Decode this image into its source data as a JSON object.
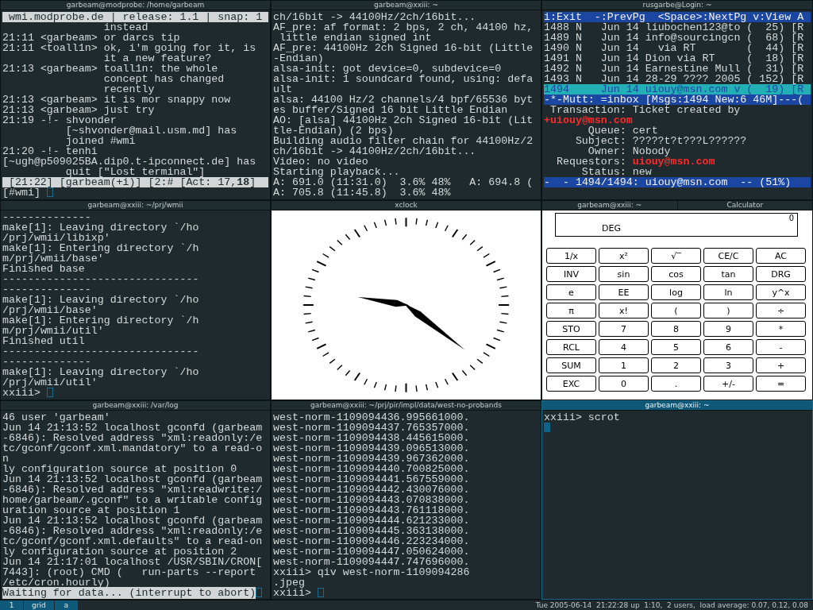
{
  "panes": [
    {
      "kind": "irc",
      "title": "garbeam@modprobe: /home/garbeam",
      "focused": false,
      "topic": " wmi.modprobe.de | release: 1.1 | snap: 1",
      "lines": [
        "                instead",
        "21:11 <garbeam> or darcs tip",
        "21:11 <toall1n> ok, i'm going for it, is",
        "                it a new feature?",
        "21:13 <garbeam> toall1n: the whole",
        "                concept has changed",
        "                recently",
        "21:13 <garbeam> it is mor snappy now",
        "21:13 <garbeam> just try",
        "21:19 -!- shvonder",
        "          [~shvonder@mail.usm.md] has",
        "          joined #wmi",
        "21:20 -!- tenhi",
        "[~ugh@p509025BA.dip0.t-ipconnect.de] has",
        "          quit [\"Lost terminal\"]"
      ],
      "status": " [21:22] [garbeam(+i)] [2:# [Act: 17,**18**]",
      "input": {
        "text": "[#wmi]",
        "highlighted": false
      },
      "cursor": true
    },
    {
      "kind": "terminal",
      "title": "garbeam@xxiii: ~",
      "focused": false,
      "lines": [
        "ch/16bit -> 44100Hz/2ch/16bit...",
        "AF_pre: af format: 2 bps, 2 ch, 44100 hz,",
        " little endian signed int",
        "AF_pre: 44100Hz 2ch Signed 16-bit (Little",
        "-Endian)",
        "alsa-init: got device=0, subdevice=0",
        "alsa-init: 1 soundcard found, using: defa",
        "ult",
        "alsa: 44100 Hz/2 channels/4 bpf/65536 byt",
        "es buffer/Signed 16 bit Little Endian",
        "AO: [alsa] 44100Hz 2ch Signed 16-bit (Lit",
        "tle-Endian) (2 bps)",
        "Building audio filter chain for 44100Hz/2",
        "ch/16bit -> 44100Hz/2ch/16bit...",
        "Video: no video",
        "Starting playback...",
        "A: 691.0 (11:31.0)  3.6% 48%   A: 694.8 (",
        "A: 705.8 (11:45.8)  3.6% 48%"
      ]
    },
    {
      "kind": "mutt",
      "title": "rusgarbe@Login: ~",
      "focused": false,
      "help": "i:Exit  -:PrevPg  <Space>:NextPg v:View A",
      "messages": [
        {
          "text": "1488 N   Jun 14 liubochen123@to (  25) [R",
          "selected": false
        },
        {
          "text": "1489 N   Jun 14 info@sourcingcn (  68) [R",
          "selected": false
        },
        {
          "text": "1490 N   Jun 14   via RT        (  44) [R",
          "selected": false
        },
        {
          "text": "1491 N   Jun 14 Dion via RT     (  18) [R",
          "selected": false
        },
        {
          "text": "1492 N   Jun 14 Earnestine Mull (  31) [R",
          "selected": false
        },
        {
          "text": "1493 N   Jun 14 28-29 ???? 2005 ( 152) [R",
          "selected": false
        },
        {
          "text": "1494     Jun 14 uiouy@msn.com v (  19) [R",
          "selected": true
        }
      ],
      "status": "-*-Mutt: =inbox [Msgs:1494 New:6 46M]---(",
      "body": [
        {
          "text": " Transaction: Ticket created by",
          "highlighted": false
        },
        {
          "text": "+uiouy@msn.com",
          "highlighted": true
        }
      ],
      "headers": [
        {
          "label": "Queue:",
          "value": "cert",
          "highlighted": false
        },
        {
          "label": "Subject:",
          "value": "?????t?t???L??????",
          "highlighted": false
        },
        {
          "label": "Owner:",
          "value": "Nobody",
          "highlighted": false
        },
        {
          "label": "Requestors:",
          "value": "uiouy@msn.com",
          "highlighted": true
        },
        {
          "label": "Status:",
          "value": "new",
          "highlighted": false
        }
      ],
      "pager_status": "-  - 1494/1494: uiouy@msn.com  -- (51%)"
    },
    {
      "kind": "terminal",
      "title": "garbeam@xxiii: ~/prj/wmii",
      "focused": false,
      "lines": [
        "--------------",
        "make[1]: Leaving directory `/ho",
        "/prj/wmii/libixp'",
        "make[1]: Entering directory `/h",
        "m/prj/wmii/base'",
        "Finished base",
        "-------------------------------",
        "--------------",
        "make[1]: Leaving directory `/ho",
        "/prj/wmii/base'",
        "make[1]: Entering directory `/h",
        "m/prj/wmii/util'",
        "Finished util",
        "-------------------------------",
        "--------------",
        "make[1]: Leaving directory `/ho",
        "/prj/wmii/util'"
      ],
      "input": {
        "text": "xxiii>",
        "highlighted": false
      },
      "cursor": true
    },
    {
      "kind": "clock",
      "title": "xclock",
      "focused": false
    },
    {
      "kind": "calculator",
      "tabs": [
        "garbeam@xxiii: ~",
        "Calculator"
      ],
      "focused": false,
      "display": {
        "value": "0",
        "mode": "DEG"
      },
      "keys": [
        "1/x",
        "x²",
        "√‾",
        "CE/C",
        "AC",
        "INV",
        "sin",
        "cos",
        "tan",
        "DRG",
        "e",
        "EE",
        "log",
        "ln",
        "y^x",
        "π",
        "x!",
        "(",
        ")",
        "÷",
        "STO",
        "7",
        "8",
        "9",
        "*",
        "RCL",
        "4",
        "5",
        "6",
        "-",
        "SUM",
        "1",
        "2",
        "3",
        "+",
        "EXC",
        "0",
        ".",
        "+/-",
        "="
      ]
    },
    {
      "kind": "terminal",
      "title": "garbeam@xxiii: /var/log",
      "focused": false,
      "lines": [
        "46 user 'garbeam'",
        "Jun 14 21:13:52 localhost gconfd (garbeam",
        "-6846): Resolved address \"xml:readonly:/e",
        "tc/gconf/gconf.xml.mandatory\" to a read-o",
        "n",
        "ly configuration source at position 0",
        "Jun 14 21:13:52 localhost gconfd (garbeam",
        "-6846): Resolved address \"xml:readwrite:/",
        "home/garbeam/.gconf\" to a writable config",
        "uration source at position 1",
        "Jun 14 21:13:52 localhost gconfd (garbeam",
        "-6846): Resolved address \"xml:readonly:/e",
        "tc/gconf/gconf.xml.defaults\" to a read-on",
        "ly configuration source at position 2",
        "Jun 14 21:17:01 localhost /USR/SBIN/CRON[",
        "7443]: (root) CMD (   run-parts --report",
        "/etc/cron.hourly)"
      ],
      "input": {
        "text": "Waiting for data... (interrupt to abort)",
        "highlighted": true
      },
      "cursor": true
    },
    {
      "kind": "terminal",
      "title": "garbeam@xxiii: ~/prj/pir/impl/data/west-no-probands",
      "focused": false,
      "lines": [
        "west-norm-1109094436.995661000.",
        "west-norm-1109094437.765357000.",
        "west-norm-1109094438.445615000.",
        "west-norm-1109094439.096513000.",
        "west-norm-1109094439.967362000.",
        "west-norm-1109094440.700825000.",
        "west-norm-1109094441.567559000.",
        "west-norm-1109094442.430076000.",
        "west-norm-1109094443.070838000.",
        "west-norm-1109094443.761118000.",
        "west-norm-1109094444.621233000.",
        "west-norm-1109094445.363138000.",
        "west-norm-1109094446.223234000.",
        "west-norm-1109094447.050624000.",
        "west-norm-1109094447.747696000.",
        "xxiii> qiv west-norm-1109094286",
        ".jpeg"
      ],
      "input": {
        "text": "xxiii>",
        "highlighted": false
      },
      "cursor": true
    },
    {
      "kind": "terminal",
      "title": "garbeam@xxiii: ~",
      "focused": true,
      "lines": [
        "xxiii> scrot"
      ],
      "cursor": true
    }
  ],
  "bar": {
    "tags": [
      "1",
      "grid",
      "a"
    ],
    "status": "Tue 2005-06-14  21:22:28 up  1:10,  2 users,  load average: 0.07, 0.12, 0.08"
  }
}
